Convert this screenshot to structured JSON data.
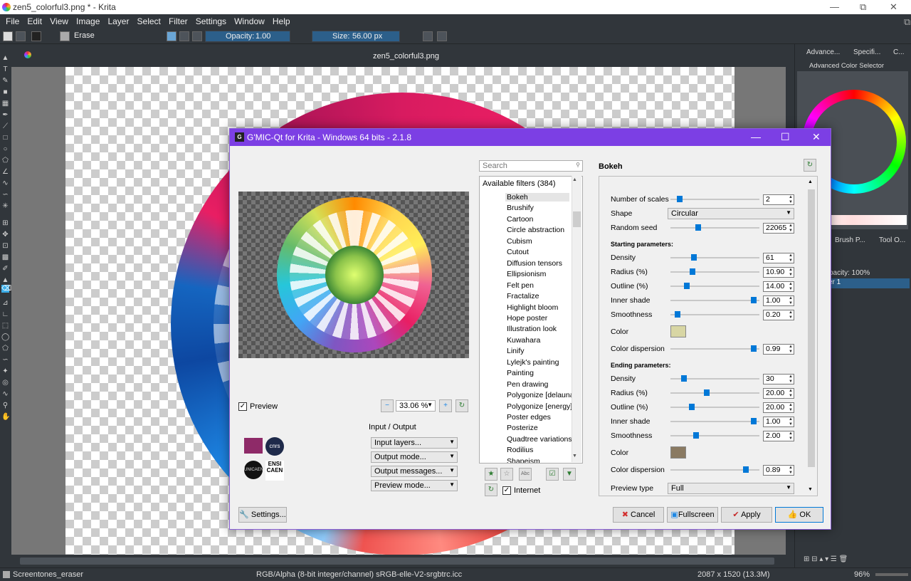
{
  "window": {
    "title": "zen5_colorful3.png * - Krita"
  },
  "menu": [
    "File",
    "Edit",
    "View",
    "Image",
    "Layer",
    "Select",
    "Filter",
    "Settings",
    "Window",
    "Help"
  ],
  "tool_options": {
    "brush_preset": "Erase",
    "opacity_label": "Opacity:",
    "opacity_value": "1.00",
    "size_label": "Size:",
    "size_value": "56.00 px"
  },
  "document_tab": "zen5_colorful3.png",
  "dockers": {
    "tabs": [
      "Advance...",
      "Specifi...",
      "C..."
    ],
    "color_selector_title": "Advanced Color Selector",
    "lower_tabs": [
      "Brush P...",
      "Tool O..."
    ],
    "layer_opacity": "pacity:  100%",
    "layer_name": "er 1"
  },
  "status": {
    "brush": "Screentones_eraser",
    "color_model": "RGB/Alpha (8-bit integer/channel)  sRGB-elle-V2-srgbtrc.icc",
    "dimensions": "2087 x 1520 (13.3M)",
    "zoom": "96%"
  },
  "gmic": {
    "title": "G'MIC-Qt for Krita - Windows 64 bits - 2.1.8",
    "preview_label": "Preview",
    "zoom_value": "33.06 %",
    "io_title": "Input / Output",
    "io_combos": [
      "Input layers...",
      "Output mode...",
      "Output messages...",
      "Preview mode..."
    ],
    "settings_button": "Settings...",
    "search_placeholder": "Search",
    "filters_header": "Available filters (384)",
    "filters": [
      "Bokeh",
      "Brushify",
      "Cartoon",
      "Circle abstraction",
      "Cubism",
      "Cutout",
      "Diffusion tensors",
      "Ellipsionism",
      "Felt pen",
      "Fractalize",
      "Highlight bloom",
      "Hope poster",
      "Illustration look",
      "Kuwahara",
      "Linify",
      "Lylejk's painting",
      "Painting",
      "Pen drawing",
      "Polygonize [delaunay]",
      "Polygonize [energy]",
      "Poster edges",
      "Posterize",
      "Quadtree variations",
      "Rodilius",
      "Shapeism"
    ],
    "internet_label": "Internet",
    "filter_name": "Bokeh",
    "params": {
      "number_of_scales": {
        "label": "Number of scales",
        "value": "2",
        "level": 0.08
      },
      "shape": {
        "label": "Shape",
        "value": "Circular"
      },
      "random_seed": {
        "label": "Random seed",
        "value": "22065",
        "level": 0.3
      },
      "starting_title": "Starting parameters:",
      "start_density": {
        "label": "Density",
        "value": "61",
        "level": 0.25
      },
      "start_radius": {
        "label": "Radius (%)",
        "value": "10.90",
        "level": 0.23
      },
      "start_outline": {
        "label": "Outline (%)",
        "value": "14.00",
        "level": 0.16
      },
      "start_inner_shade": {
        "label": "Inner shade",
        "value": "1.00",
        "level": 0.97
      },
      "start_smoothness": {
        "label": "Smoothness",
        "value": "0.20",
        "level": 0.05
      },
      "start_color": {
        "label": "Color",
        "hex": "#d8d6a4"
      },
      "start_color_dispersion": {
        "label": "Color dispersion",
        "value": "0.99",
        "level": 0.97
      },
      "ending_title": "Ending parameters:",
      "end_density": {
        "label": "Density",
        "value": "30",
        "level": 0.13
      },
      "end_radius": {
        "label": "Radius (%)",
        "value": "20.00",
        "level": 0.4
      },
      "end_outline": {
        "label": "Outline (%)",
        "value": "20.00",
        "level": 0.22
      },
      "end_inner_shade": {
        "label": "Inner shade",
        "value": "1.00",
        "level": 0.97
      },
      "end_smoothness": {
        "label": "Smoothness",
        "value": "2.00",
        "level": 0.27
      },
      "end_color": {
        "label": "Color",
        "hex": "#8a7a62"
      },
      "end_color_dispersion": {
        "label": "Color dispersion",
        "value": "0.89",
        "level": 0.87
      },
      "preview_type": {
        "label": "Preview type",
        "value": "Full"
      }
    },
    "buttons": {
      "cancel": "Cancel",
      "fullscreen": "Fullscreen",
      "apply": "Apply",
      "ok": "OK"
    }
  },
  "colors": {
    "gmic_title": "#7c3fe4",
    "accent": "#0078d7",
    "krita_bg": "#31363b"
  }
}
